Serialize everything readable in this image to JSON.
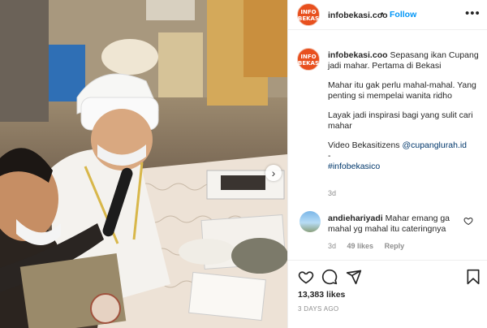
{
  "post": {
    "username": "infobekasi.coo",
    "follow_label": "Follow",
    "more_label": "•••",
    "avatar_text": [
      "INFO",
      "BEKASI"
    ],
    "caption": {
      "username": "infobekasi.coo",
      "lines": {
        "l1": "Sepasang ikan Cupang jadi mahar. Pertama di Bekasi",
        "l2": "Mahar itu gak perlu mahal-mahal. Yang penting si mempelai wanita ridho",
        "l3": "Layak jadi inspirasi bagi yang sulit cari mahar",
        "l4_prefix": "Video Bekasitizens ",
        "l4_mention": "@cupanglurah.id",
        "l5": "-",
        "l6_hashtag": "#infobekasico"
      },
      "time_ago": "3d"
    },
    "comment": {
      "username": "andiehariyadi",
      "text": "Mahar emang ga mahal yg mahal itu cateringnya",
      "time_ago": "3d",
      "likes": "49 likes",
      "reply_label": "Reply"
    },
    "likes_count": "13,383 likes",
    "posted_ago": "3 DAYS AGO",
    "icons": [
      "heart-icon",
      "comment-icon",
      "share-icon",
      "bookmark-icon",
      "chevron-right-icon",
      "more-options-icon"
    ],
    "colors": {
      "brand": "#e8501e",
      "link": "#0095f6",
      "mention": "#00376b",
      "muted": "#8e8e8e"
    }
  }
}
